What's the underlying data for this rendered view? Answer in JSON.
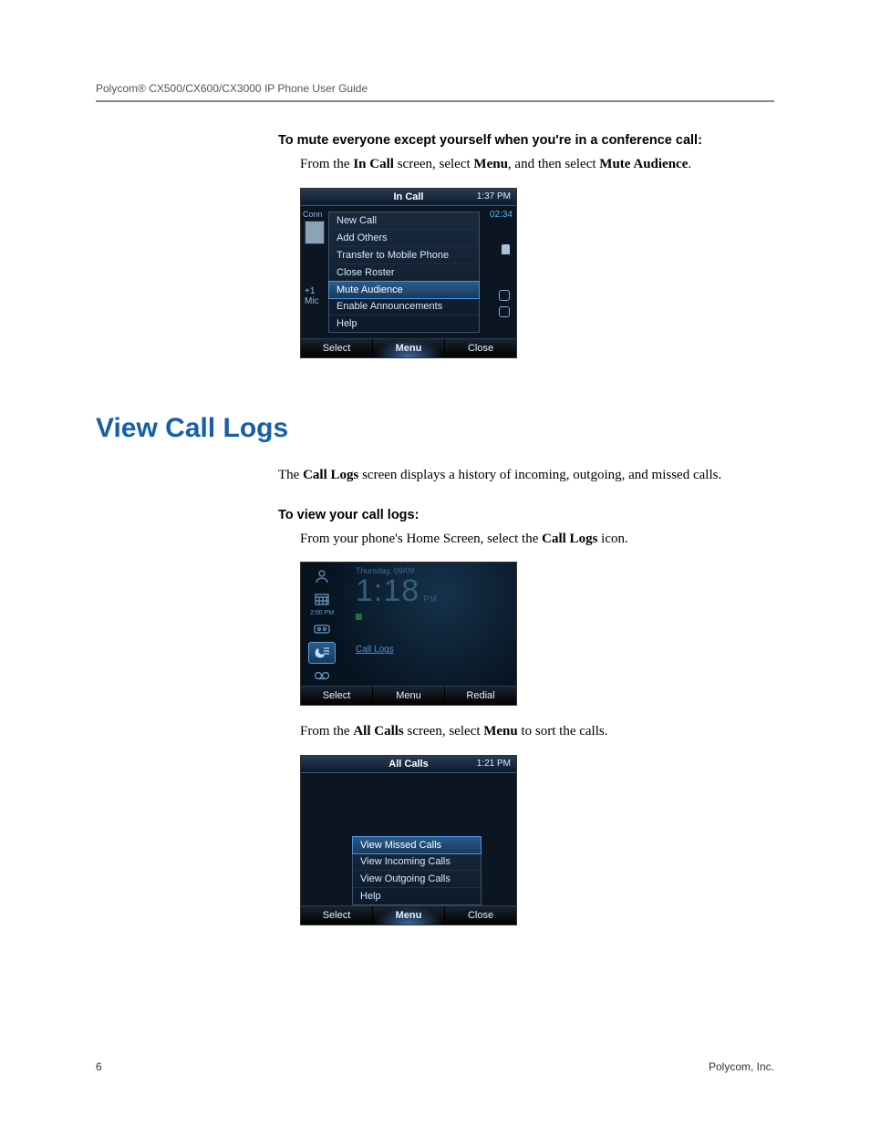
{
  "running_head": "Polycom® CX500/CX600/CX3000 IP Phone User Guide",
  "footer": {
    "page": "6",
    "company": "Polycom, Inc."
  },
  "sec1": {
    "heading": "To mute everyone except yourself when you're in a conference call:",
    "para_pre": "From the ",
    "para_b1": "In Call",
    "para_mid1": " screen, select ",
    "para_b2": "Menu",
    "para_mid2": ", and then select ",
    "para_b3": "Mute Audience",
    "para_post": "."
  },
  "shot1": {
    "title": "In Call",
    "clock": "1:37 PM",
    "bg_conn": "Conn",
    "bg_plus": "+1",
    "bg_mic": "Mic",
    "bg_duration": "02:34",
    "menu": [
      "New Call",
      "Add Others",
      "Transfer to Mobile Phone",
      "Close Roster",
      "Mute Audience",
      "Enable Announcements",
      "Help"
    ],
    "softkeys": {
      "left": "Select",
      "mid": "Menu",
      "right": "Close"
    }
  },
  "h1": "View Call Logs",
  "sec2": {
    "para_pre": "The ",
    "para_b1": "Call Logs",
    "para_post": " screen displays a history of incoming, outgoing, and missed calls."
  },
  "sec3": {
    "heading": "To view your call logs:",
    "para_pre": "From your phone's Home Screen, select the ",
    "para_b1": "Call Logs",
    "para_post": " icon."
  },
  "shot2": {
    "date": "Thursday, 09/09",
    "time": "1:18",
    "ampm": "PM",
    "sidebar_time_label": "2:00 PM",
    "hint": "Call Logs",
    "softkeys": {
      "left": "Select",
      "mid": "Menu",
      "right": "Redial"
    }
  },
  "sec4": {
    "para_pre": "From the ",
    "para_b1": "All Calls",
    "para_mid": " screen, select ",
    "para_b2": "Menu",
    "para_post": " to sort the calls."
  },
  "shot3": {
    "title": "All Calls",
    "clock": "1:21 PM",
    "menu": [
      "View Missed Calls",
      "View Incoming Calls",
      "View Outgoing Calls",
      "Help"
    ],
    "softkeys": {
      "left": "Select",
      "mid": "Menu",
      "right": "Close"
    }
  }
}
